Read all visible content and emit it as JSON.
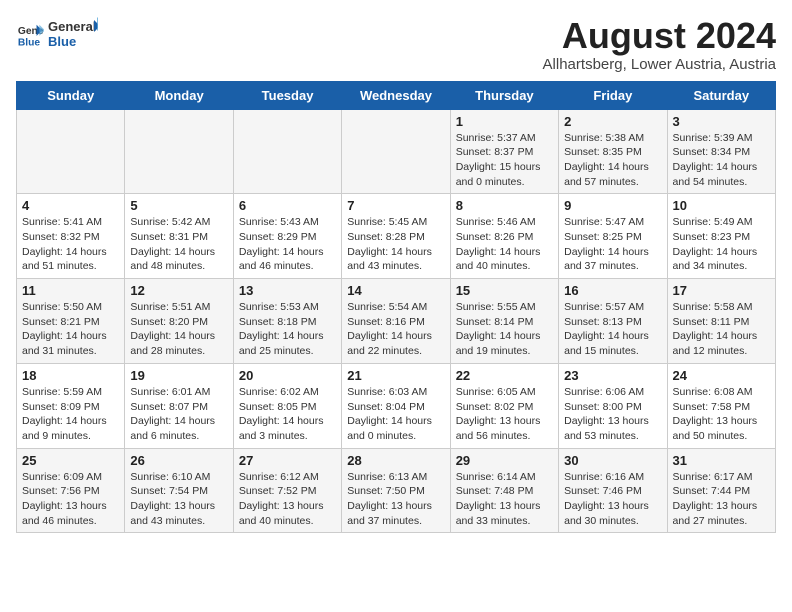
{
  "header": {
    "logo_line1": "General",
    "logo_line2": "Blue",
    "title": "August 2024",
    "subtitle": "Allhartsberg, Lower Austria, Austria"
  },
  "days_of_week": [
    "Sunday",
    "Monday",
    "Tuesday",
    "Wednesday",
    "Thursday",
    "Friday",
    "Saturday"
  ],
  "weeks": [
    [
      {
        "day": "",
        "detail": ""
      },
      {
        "day": "",
        "detail": ""
      },
      {
        "day": "",
        "detail": ""
      },
      {
        "day": "",
        "detail": ""
      },
      {
        "day": "1",
        "detail": "Sunrise: 5:37 AM\nSunset: 8:37 PM\nDaylight: 15 hours\nand 0 minutes."
      },
      {
        "day": "2",
        "detail": "Sunrise: 5:38 AM\nSunset: 8:35 PM\nDaylight: 14 hours\nand 57 minutes."
      },
      {
        "day": "3",
        "detail": "Sunrise: 5:39 AM\nSunset: 8:34 PM\nDaylight: 14 hours\nand 54 minutes."
      }
    ],
    [
      {
        "day": "4",
        "detail": "Sunrise: 5:41 AM\nSunset: 8:32 PM\nDaylight: 14 hours\nand 51 minutes."
      },
      {
        "day": "5",
        "detail": "Sunrise: 5:42 AM\nSunset: 8:31 PM\nDaylight: 14 hours\nand 48 minutes."
      },
      {
        "day": "6",
        "detail": "Sunrise: 5:43 AM\nSunset: 8:29 PM\nDaylight: 14 hours\nand 46 minutes."
      },
      {
        "day": "7",
        "detail": "Sunrise: 5:45 AM\nSunset: 8:28 PM\nDaylight: 14 hours\nand 43 minutes."
      },
      {
        "day": "8",
        "detail": "Sunrise: 5:46 AM\nSunset: 8:26 PM\nDaylight: 14 hours\nand 40 minutes."
      },
      {
        "day": "9",
        "detail": "Sunrise: 5:47 AM\nSunset: 8:25 PM\nDaylight: 14 hours\nand 37 minutes."
      },
      {
        "day": "10",
        "detail": "Sunrise: 5:49 AM\nSunset: 8:23 PM\nDaylight: 14 hours\nand 34 minutes."
      }
    ],
    [
      {
        "day": "11",
        "detail": "Sunrise: 5:50 AM\nSunset: 8:21 PM\nDaylight: 14 hours\nand 31 minutes."
      },
      {
        "day": "12",
        "detail": "Sunrise: 5:51 AM\nSunset: 8:20 PM\nDaylight: 14 hours\nand 28 minutes."
      },
      {
        "day": "13",
        "detail": "Sunrise: 5:53 AM\nSunset: 8:18 PM\nDaylight: 14 hours\nand 25 minutes."
      },
      {
        "day": "14",
        "detail": "Sunrise: 5:54 AM\nSunset: 8:16 PM\nDaylight: 14 hours\nand 22 minutes."
      },
      {
        "day": "15",
        "detail": "Sunrise: 5:55 AM\nSunset: 8:14 PM\nDaylight: 14 hours\nand 19 minutes."
      },
      {
        "day": "16",
        "detail": "Sunrise: 5:57 AM\nSunset: 8:13 PM\nDaylight: 14 hours\nand 15 minutes."
      },
      {
        "day": "17",
        "detail": "Sunrise: 5:58 AM\nSunset: 8:11 PM\nDaylight: 14 hours\nand 12 minutes."
      }
    ],
    [
      {
        "day": "18",
        "detail": "Sunrise: 5:59 AM\nSunset: 8:09 PM\nDaylight: 14 hours\nand 9 minutes."
      },
      {
        "day": "19",
        "detail": "Sunrise: 6:01 AM\nSunset: 8:07 PM\nDaylight: 14 hours\nand 6 minutes."
      },
      {
        "day": "20",
        "detail": "Sunrise: 6:02 AM\nSunset: 8:05 PM\nDaylight: 14 hours\nand 3 minutes."
      },
      {
        "day": "21",
        "detail": "Sunrise: 6:03 AM\nSunset: 8:04 PM\nDaylight: 14 hours\nand 0 minutes."
      },
      {
        "day": "22",
        "detail": "Sunrise: 6:05 AM\nSunset: 8:02 PM\nDaylight: 13 hours\nand 56 minutes."
      },
      {
        "day": "23",
        "detail": "Sunrise: 6:06 AM\nSunset: 8:00 PM\nDaylight: 13 hours\nand 53 minutes."
      },
      {
        "day": "24",
        "detail": "Sunrise: 6:08 AM\nSunset: 7:58 PM\nDaylight: 13 hours\nand 50 minutes."
      }
    ],
    [
      {
        "day": "25",
        "detail": "Sunrise: 6:09 AM\nSunset: 7:56 PM\nDaylight: 13 hours\nand 46 minutes."
      },
      {
        "day": "26",
        "detail": "Sunrise: 6:10 AM\nSunset: 7:54 PM\nDaylight: 13 hours\nand 43 minutes."
      },
      {
        "day": "27",
        "detail": "Sunrise: 6:12 AM\nSunset: 7:52 PM\nDaylight: 13 hours\nand 40 minutes."
      },
      {
        "day": "28",
        "detail": "Sunrise: 6:13 AM\nSunset: 7:50 PM\nDaylight: 13 hours\nand 37 minutes."
      },
      {
        "day": "29",
        "detail": "Sunrise: 6:14 AM\nSunset: 7:48 PM\nDaylight: 13 hours\nand 33 minutes."
      },
      {
        "day": "30",
        "detail": "Sunrise: 6:16 AM\nSunset: 7:46 PM\nDaylight: 13 hours\nand 30 minutes."
      },
      {
        "day": "31",
        "detail": "Sunrise: 6:17 AM\nSunset: 7:44 PM\nDaylight: 13 hours\nand 27 minutes."
      }
    ]
  ]
}
